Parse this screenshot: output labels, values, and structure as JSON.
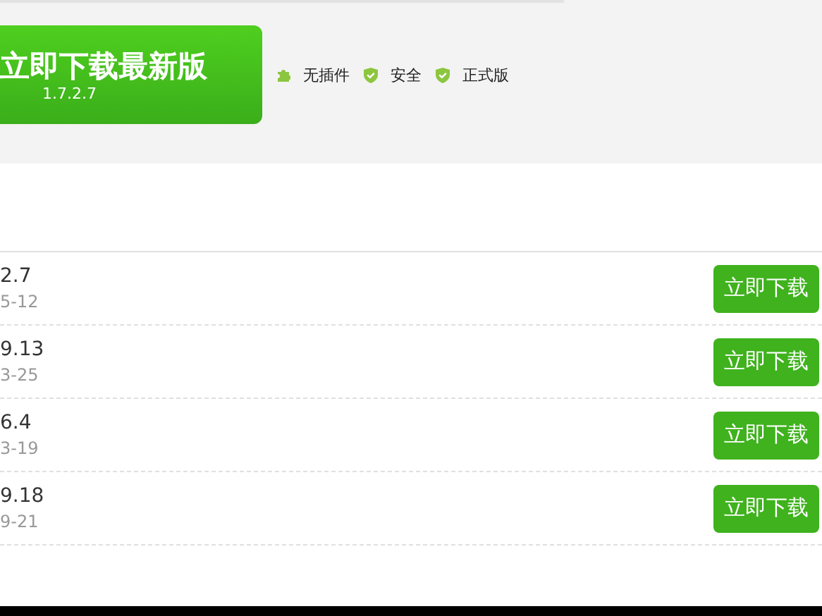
{
  "hero": {
    "button": {
      "label": "立即下载最新版",
      "version": "1.7.2.7"
    },
    "features": [
      {
        "kind": "plugin",
        "label": "无插件"
      },
      {
        "kind": "shield",
        "label": "安全"
      },
      {
        "kind": "shield",
        "label": "正式版"
      }
    ]
  },
  "versions": [
    {
      "version": "2.7",
      "date": "5-12",
      "button": "立即下载"
    },
    {
      "version": "9.13",
      "date": "3-25",
      "button": "立即下载"
    },
    {
      "version": "6.4",
      "date": "3-19",
      "button": "立即下载"
    },
    {
      "version": "9.18",
      "date": "9-21",
      "button": "立即下载"
    }
  ]
}
